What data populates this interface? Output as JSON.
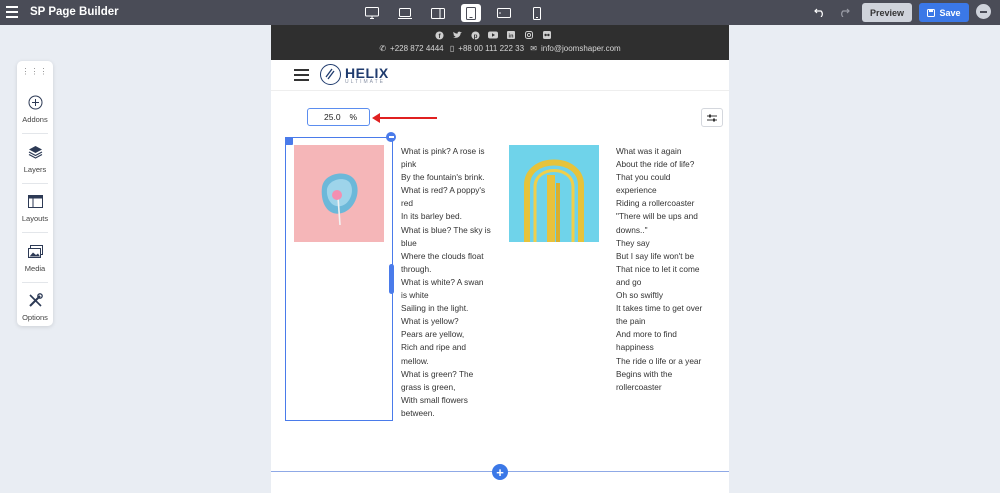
{
  "app": {
    "title": "SP Page Builder"
  },
  "toolbar": {
    "devices": [
      {
        "name": "desktop-large",
        "icon": "monitor-icon",
        "active": false
      },
      {
        "name": "desktop",
        "icon": "laptop-icon",
        "active": false
      },
      {
        "name": "tablet-landscape",
        "icon": "tablet-landscape-icon",
        "active": false
      },
      {
        "name": "tablet",
        "icon": "tablet-icon",
        "active": true
      },
      {
        "name": "mobile-landscape",
        "icon": "mobile-landscape-icon",
        "active": false
      },
      {
        "name": "mobile",
        "icon": "mobile-icon",
        "active": false
      }
    ],
    "preview_label": "Preview",
    "save_label": "Save"
  },
  "sidebar": {
    "items": [
      {
        "label": "Addons",
        "icon": "plus-circle-icon"
      },
      {
        "label": "Layers",
        "icon": "layers-icon"
      },
      {
        "label": "Layouts",
        "icon": "layout-icon"
      },
      {
        "label": "Media",
        "icon": "media-icon"
      },
      {
        "label": "Options",
        "icon": "tools-icon"
      }
    ]
  },
  "site": {
    "social_icons": [
      "facebook-icon",
      "twitter-icon",
      "pinterest-icon",
      "youtube-icon",
      "linkedin-icon",
      "instagram-icon",
      "flickr-icon"
    ],
    "phone": "+228 872 4444",
    "mobile": "+88 00 111 222 33",
    "email": "info@joomshaper.com",
    "logo_text": "HELIX",
    "logo_sub": "ULTIMATE"
  },
  "column_width": {
    "value": "25.0",
    "unit": "%"
  },
  "poem_1": [
    "What is pink? A rose is",
    "pink",
    "By the fountain's brink.",
    "What is red? A poppy's",
    "red",
    "In its barley bed.",
    "What is blue? The sky is",
    "blue",
    "Where the clouds float",
    "through.",
    "What is white? A swan",
    "is white",
    "Sailing in the light.",
    "What is yellow?",
    "Pears are yellow,",
    "Rich and ripe and",
    "mellow.",
    "What is green? The",
    "grass is green,",
    "With small flowers",
    "between."
  ],
  "poem_2": [
    "What was it again",
    "About the ride of life?",
    "That you could",
    "experience",
    "Riding a rollercoaster",
    "\"There will be ups and",
    "downs..\"",
    "They say",
    "But I say life won't be",
    "That nice to let it come",
    "and go",
    "Oh so swiftly",
    "It takes time to get over",
    "the pain",
    "And more to find",
    "happiness",
    "The ride o life or a year",
    "Begins with the",
    "rollercoaster"
  ],
  "colors": {
    "topbar": "#4a4c57",
    "accent": "#3b78e7",
    "arrow": "#e02020"
  }
}
